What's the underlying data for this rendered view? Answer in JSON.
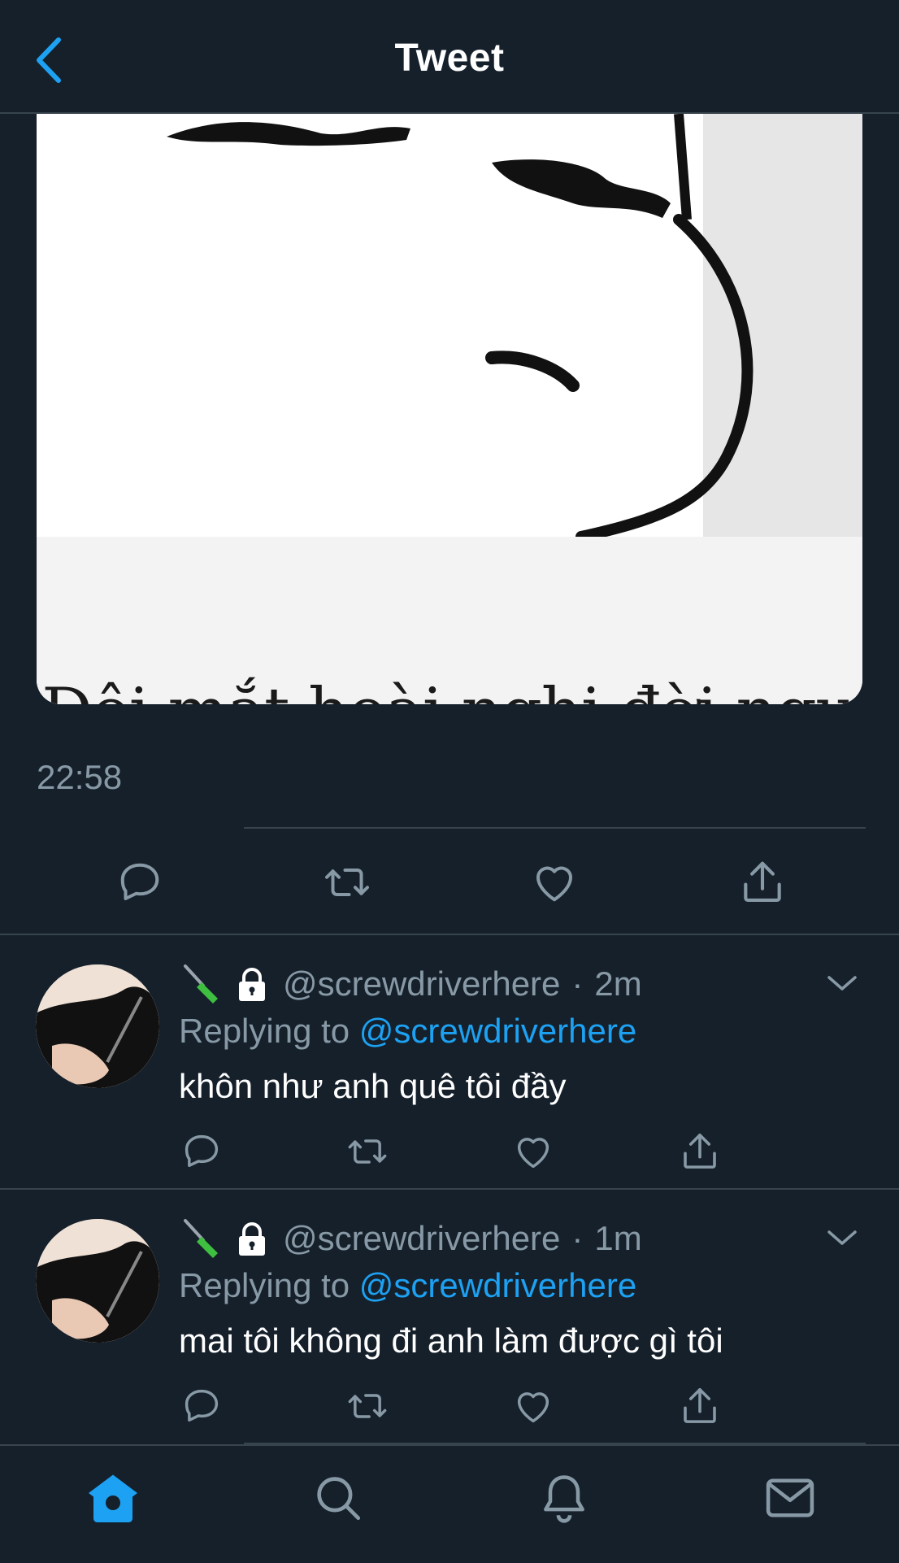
{
  "header": {
    "title": "Tweet",
    "back_icon": "chevron-left-icon",
    "accent_color": "#1da1f2"
  },
  "tweet": {
    "image_caption": "Đôi mắt hoài nghi đời người",
    "timestamp": "22:58",
    "actions": [
      "reply-icon",
      "retweet-icon",
      "like-icon",
      "share-icon"
    ]
  },
  "replies": [
    {
      "handle": "@screwdriverhere",
      "separator": "·",
      "time": "2m",
      "replying_prefix": "Replying to",
      "replying_to": "@screwdriverhere",
      "text": "khôn như anh quê tôi đầy"
    },
    {
      "handle": "@screwdriverhere",
      "separator": "·",
      "time": "1m",
      "replying_prefix": "Replying to",
      "replying_to": "@screwdriverhere",
      "text": "mai tôi không đi anh làm được gì tôi"
    }
  ],
  "tabbar": {
    "items": [
      "home-icon",
      "search-icon",
      "notifications-icon",
      "messages-icon"
    ],
    "active": "home-icon"
  },
  "colors": {
    "background": "#15202b",
    "secondary_text": "#8899a6",
    "divider": "#38444d",
    "mention": "#1da1f2"
  }
}
